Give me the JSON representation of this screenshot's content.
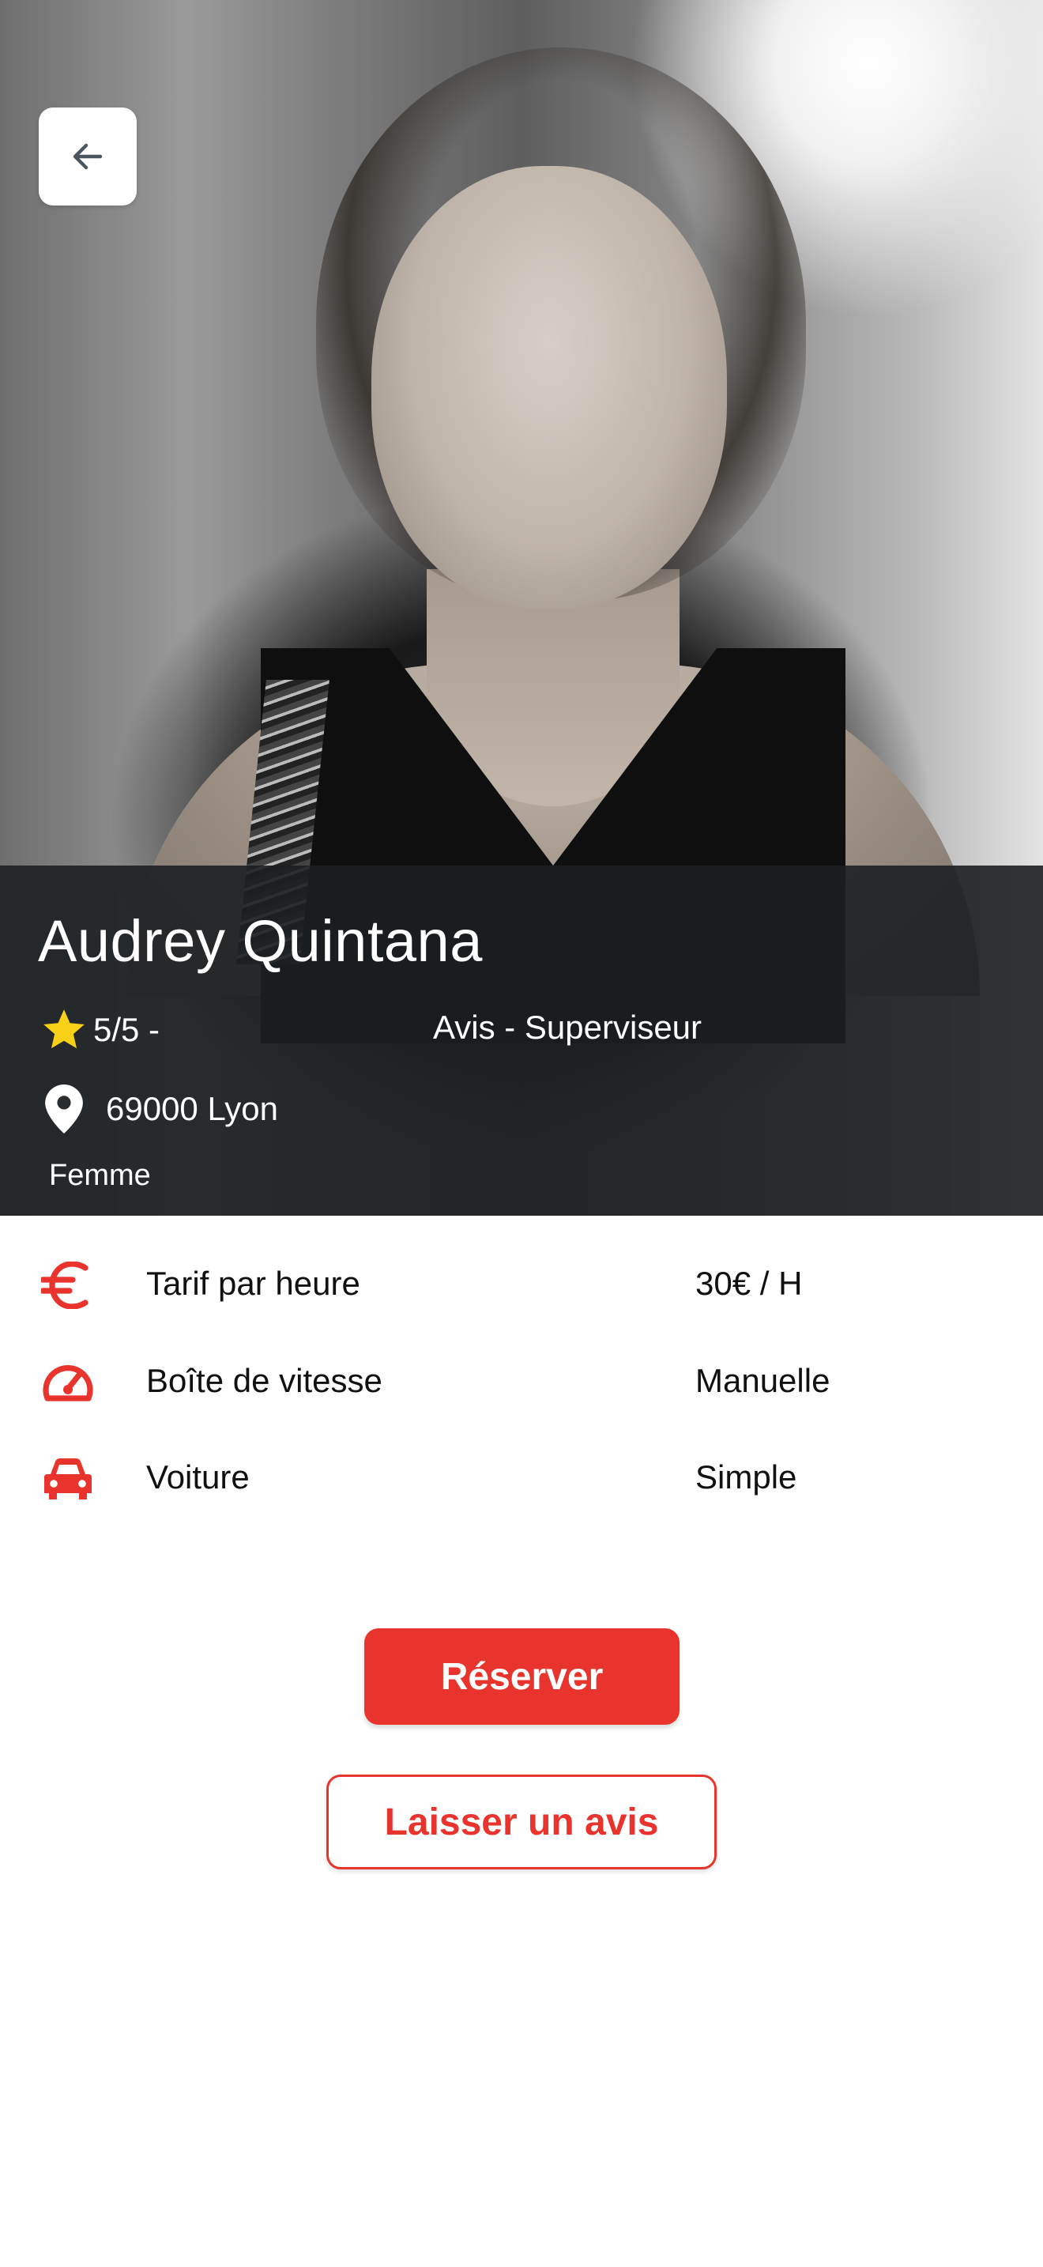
{
  "profile": {
    "name": "Audrey Quintana",
    "rating_text": "5/5 -",
    "review_role": "Avis - Superviseur",
    "location": "69000 Lyon",
    "gender": "Femme",
    "photo_description_icon": "profile-photo"
  },
  "details": [
    {
      "icon": "euro-icon",
      "label": "Tarif par heure",
      "value": "30€ / H"
    },
    {
      "icon": "speedometer-icon",
      "label": "Boîte de vitesse",
      "value": "Manuelle"
    },
    {
      "icon": "car-icon",
      "label": "Voiture",
      "value": "Simple"
    }
  ],
  "actions": {
    "reserve_label": "Réserver",
    "review_label": "Laisser un avis"
  },
  "colors": {
    "accent": "#e8342c",
    "star": "#f7d117",
    "overlay": "#1c1f22"
  }
}
